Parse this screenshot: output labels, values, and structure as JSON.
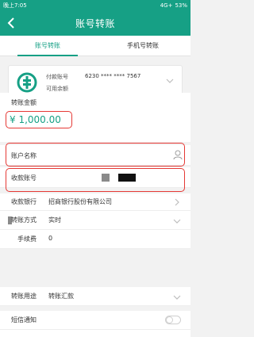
{
  "status_bar": {
    "time": "晚上7:05",
    "network": "4G+",
    "battery": "53%"
  },
  "header": {
    "title": "账号转账"
  },
  "tabs": [
    {
      "label": "账号转账",
      "active": true
    },
    {
      "label": "手机号转账",
      "active": false
    }
  ],
  "payer": {
    "label_account": "付款账号",
    "label_balance": "可用余额",
    "account_number": "6230 **** **** 7567"
  },
  "amount": {
    "label": "转账金额",
    "value": "¥ 1,000.00"
  },
  "form": {
    "account_name_label": "账户名称",
    "account_name_value": "",
    "payee_account_label": "收款账号",
    "payee_bank_label": "收款银行",
    "payee_bank_value": "招商银行股份有限公司",
    "transfer_method_label": "转账方式",
    "transfer_method_value": "实时",
    "fee_label": "手续费",
    "fee_value": "0",
    "purpose_label": "转账用途",
    "purpose_value": "转账汇款",
    "sms_label": "短信通知"
  },
  "colors": {
    "brand": "#16a085",
    "highlight": "#e53935"
  }
}
